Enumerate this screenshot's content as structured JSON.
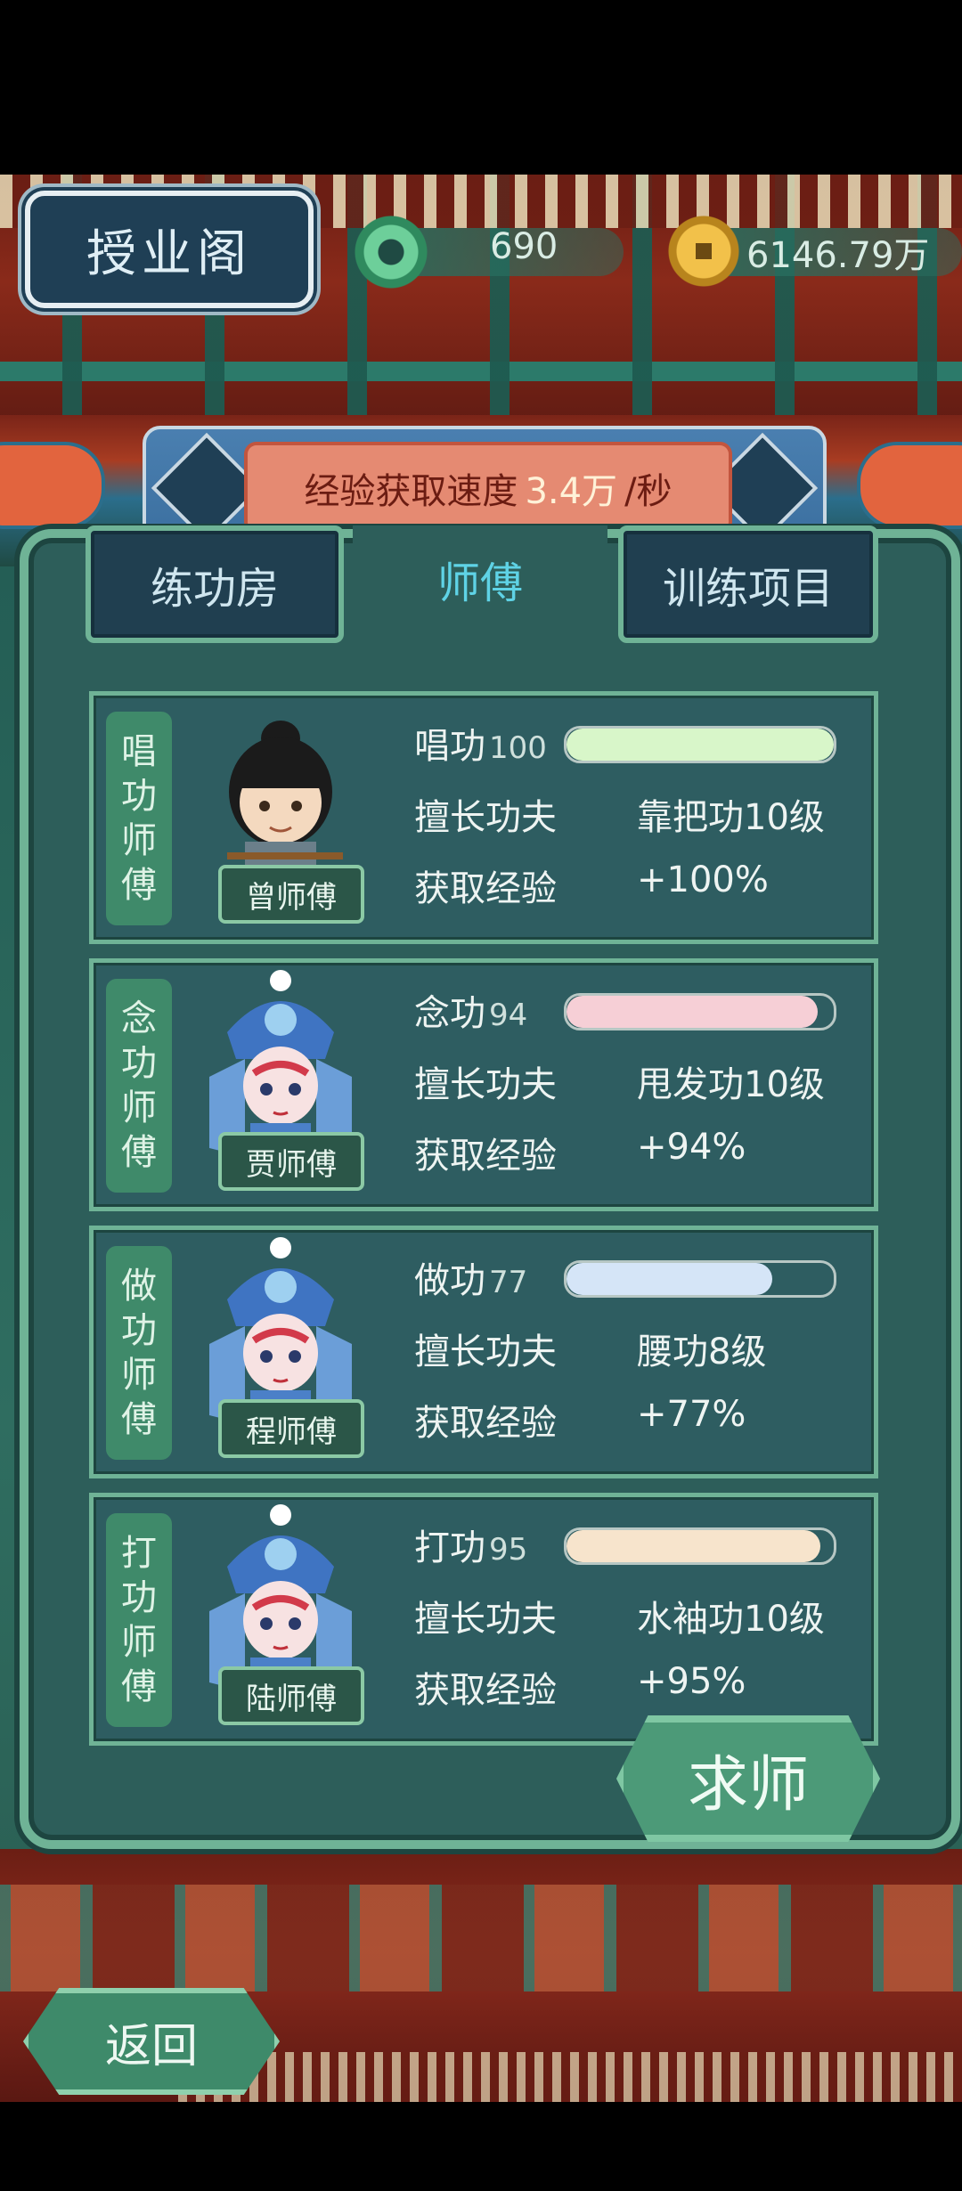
{
  "header": {
    "title": "授业阁",
    "jade_value": "690",
    "coin_value": "6146.79万"
  },
  "exp_banner": {
    "prefix": "经验获取速度",
    "value": "3.4万",
    "suffix": "/秒"
  },
  "tabs": [
    {
      "label": "练功房",
      "active": false
    },
    {
      "label": "师傅",
      "active": true
    },
    {
      "label": "训练项目",
      "active": false
    }
  ],
  "masters": [
    {
      "type_label": [
        "唱",
        "功",
        "师",
        "傅"
      ],
      "name": "曾师傅",
      "skill_label": "唱功",
      "skill_value": "100",
      "skill_fraction": 1.0,
      "bar_color": "#d8f6c9",
      "specialty_label": "擅长功夫",
      "specialty": "靠把功10级",
      "exp_label": "获取经验",
      "exp_bonus": "+100%"
    },
    {
      "type_label": [
        "念",
        "功",
        "师",
        "傅"
      ],
      "name": "贾师傅",
      "skill_label": "念功",
      "skill_value": "94",
      "skill_fraction": 0.94,
      "bar_color": "#f6cfd6",
      "specialty_label": "擅长功夫",
      "specialty": "甩发功10级",
      "exp_label": "获取经验",
      "exp_bonus": "+94%"
    },
    {
      "type_label": [
        "做",
        "功",
        "师",
        "傅"
      ],
      "name": "程师傅",
      "skill_label": "做功",
      "skill_value": "77",
      "skill_fraction": 0.77,
      "bar_color": "#d5e5f7",
      "specialty_label": "擅长功夫",
      "specialty": "腰功8级",
      "exp_label": "获取经验",
      "exp_bonus": "+77%"
    },
    {
      "type_label": [
        "打",
        "功",
        "师",
        "傅"
      ],
      "name": "陆师傅",
      "skill_label": "打功",
      "skill_value": "95",
      "skill_fraction": 0.95,
      "bar_color": "#f7e4cc",
      "specialty_label": "擅长功夫",
      "specialty": "水袖功10级",
      "exp_label": "获取经验",
      "exp_bonus": "+95%"
    }
  ],
  "buttons": {
    "seek_master": "求师",
    "back": "返回"
  }
}
